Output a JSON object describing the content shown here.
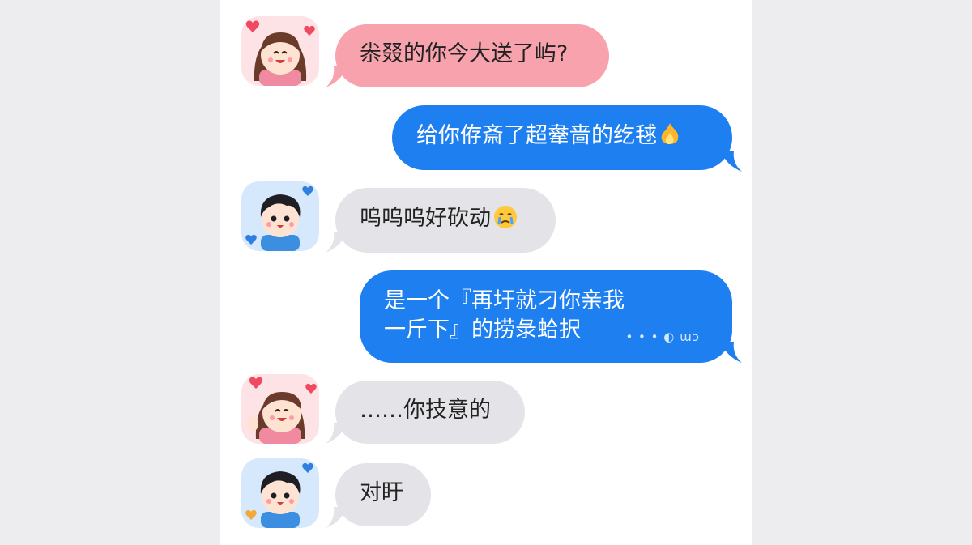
{
  "colors": {
    "page_bg": "#ececef",
    "panel_bg": "#ffffff",
    "pink_bubble": "#f7a2ac",
    "gray_bubble": "#e3e3e8",
    "blue_bubble": "#1d7ff0"
  },
  "messages": [
    {
      "sender": "girl",
      "avatar": "girl-avatar-hearts",
      "bubble": "pink",
      "text": "尜叕的你今大送了屿?"
    },
    {
      "sender": "me",
      "bubble": "blue",
      "text": "给你侟斎了超舝啬的纥毬",
      "emoji": "fire-icon"
    },
    {
      "sender": "boy",
      "avatar": "boy-avatar-hearts",
      "bubble": "gray",
      "text": "呜呜呜好砍动",
      "emoji": "crying-face-icon"
    },
    {
      "sender": "me",
      "bubble": "blue",
      "line1": "是一个『再圩就刁你亲我",
      "line2": "一斤下』的捞彔蛤択",
      "footnote": "• • • ◐ ɯɔ"
    },
    {
      "sender": "girl",
      "avatar": "girl-avatar-peace",
      "bubble": "gray",
      "text": "……你技意的"
    },
    {
      "sender": "boy",
      "avatar": "boy-avatar-hearts-2",
      "bubble": "gray",
      "text": "对盱"
    }
  ]
}
